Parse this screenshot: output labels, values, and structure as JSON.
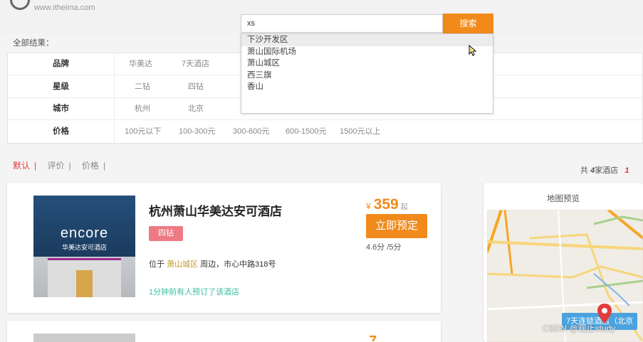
{
  "header": {
    "logo_url_text": "www.itheima.com",
    "search_value": "xs",
    "search_button": "搜索",
    "suggestions": [
      "下沙开发区",
      "萧山国际机场",
      "萧山城区",
      "西三旗",
      "香山"
    ]
  },
  "filters": {
    "all_results_label": "全部结果：",
    "rows": [
      {
        "label": "品牌",
        "options": [
          "华美达",
          "7天酒店"
        ]
      },
      {
        "label": "星级",
        "options": [
          "二钻",
          "四钻"
        ]
      },
      {
        "label": "城市",
        "options": [
          "杭州",
          "北京"
        ]
      },
      {
        "label": "价格",
        "options": [
          "100元以下",
          "100-300元",
          "300-600元",
          "600-1500元",
          "1500元以上"
        ]
      }
    ]
  },
  "sort": {
    "items": [
      "默认",
      "评价",
      "价格"
    ],
    "separator": "|"
  },
  "result_count": {
    "prefix": "共",
    "count": "4",
    "suffix": "家酒店",
    "page": "1"
  },
  "hotel": {
    "name": "杭州萧山华美达安可酒店",
    "star": "四钻",
    "address_prefix": "位于",
    "address_area": "萧山城区",
    "address_suffix": "周边，市心中路318号",
    "booked_text": "1分钟前有人预订了该酒店",
    "price_currency": "¥",
    "price": "359",
    "price_suffix": "起",
    "book_button": "立即预定",
    "score": "4.6分 /5分",
    "image_logo": "encore",
    "image_sub": "华美达安可酒店"
  },
  "map": {
    "title": "地图预览",
    "marker_label": "7天连锁酒店（北京"
  },
  "watermark": "CSDN @观止study",
  "colors": {
    "accent": "#f18a1b",
    "tag": "#ee7a83",
    "highlight_red": "#e4393c",
    "booked_green": "#3bbfa0",
    "map_label_blue": "#4aa3df"
  }
}
